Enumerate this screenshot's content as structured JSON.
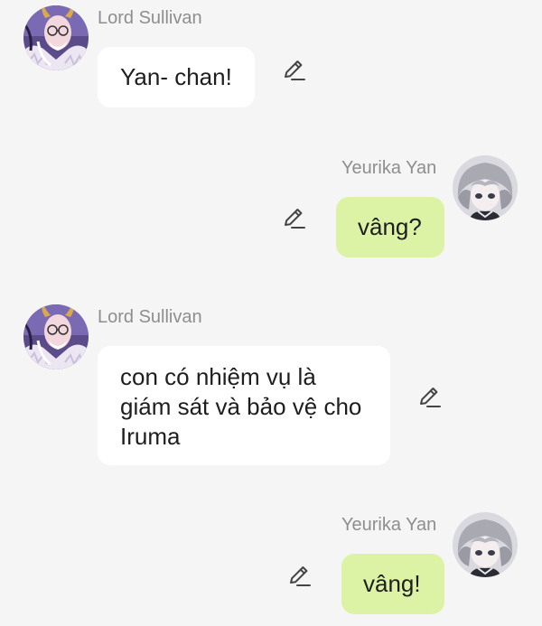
{
  "messages": [
    {
      "side": "left",
      "sender": "Lord Sullivan",
      "text": "Yan- chan!",
      "avatar_icon": "lord-sullivan-avatar"
    },
    {
      "side": "right",
      "sender": "Yeurika Yan",
      "text": "vâng?",
      "avatar_icon": "yeurika-yan-avatar"
    },
    {
      "side": "left",
      "sender": "Lord Sullivan",
      "text": "con có nhiệm vụ là giám sát và bảo vệ cho Iruma",
      "avatar_icon": "lord-sullivan-avatar"
    },
    {
      "side": "right",
      "sender": "Yeurika Yan",
      "text": "vâng!",
      "avatar_icon": "yeurika-yan-avatar"
    }
  ],
  "icons": {
    "edit": "pencil-icon"
  },
  "colors": {
    "background": "#f5f5f5",
    "incoming_bubble": "#ffffff",
    "outgoing_bubble": "#dcf3a6",
    "sender_name": "#8e8e8e"
  }
}
